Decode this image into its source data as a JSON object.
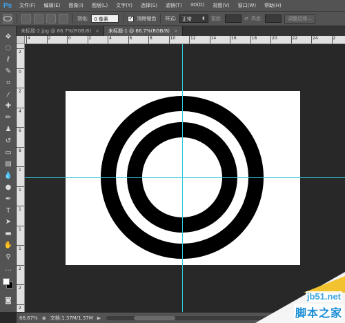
{
  "app": {
    "logo": "Ps"
  },
  "menu": [
    "文件(F)",
    "编辑(E)",
    "图像(I)",
    "图层(L)",
    "文字(Y)",
    "选择(S)",
    "滤镜(T)",
    "3D(D)",
    "视图(V)",
    "窗口(W)",
    "帮助(H)"
  ],
  "options": {
    "feather_label": "羽化:",
    "feather_value": "0 像素",
    "antialias_label": "消除锯齿",
    "antialias_checked": true,
    "style_label": "样式:",
    "style_value": "正常",
    "width_label": "宽度:",
    "height_label": "高度:",
    "refine_edge_label": "调整边缘..."
  },
  "tabs": [
    {
      "label": "未标题-2.jpg @ 66.7%(RGB/8)",
      "close": "×",
      "active": false
    },
    {
      "label": "未标题-1 @ 66.7%(RGB/8)",
      "close": "×",
      "active": true
    }
  ],
  "ruler_top": [
    "4",
    "2",
    "0",
    "2",
    "4",
    "6",
    "8",
    "10",
    "12",
    "14",
    "16",
    "18",
    "20",
    "22",
    "24",
    "2"
  ],
  "ruler_left": [
    "2",
    "0",
    "2",
    "4",
    "6",
    "8",
    "1",
    "1",
    "1",
    "1",
    "1",
    "2",
    "2",
    "2"
  ],
  "tools": [
    {
      "name": "move-tool",
      "glyph": "✥"
    },
    {
      "name": "marquee-tool",
      "glyph": "◌"
    },
    {
      "name": "lasso-tool",
      "glyph": "ℓ"
    },
    {
      "name": "quick-select-tool",
      "glyph": "✎"
    },
    {
      "name": "crop-tool",
      "glyph": "⌗"
    },
    {
      "name": "eyedropper-tool",
      "glyph": "⁄"
    },
    {
      "name": "healing-tool",
      "glyph": "✚"
    },
    {
      "name": "brush-tool",
      "glyph": "✏"
    },
    {
      "name": "stamp-tool",
      "glyph": "♟"
    },
    {
      "name": "history-brush-tool",
      "glyph": "↺"
    },
    {
      "name": "eraser-tool",
      "glyph": "▭"
    },
    {
      "name": "gradient-tool",
      "glyph": "▤"
    },
    {
      "name": "blur-tool",
      "glyph": "💧"
    },
    {
      "name": "dodge-tool",
      "glyph": "●"
    },
    {
      "name": "pen-tool",
      "glyph": "✒"
    },
    {
      "name": "type-tool",
      "glyph": "T"
    },
    {
      "name": "path-select-tool",
      "glyph": "➤"
    },
    {
      "name": "shape-tool",
      "glyph": "▬"
    },
    {
      "name": "hand-tool",
      "glyph": "✋"
    },
    {
      "name": "zoom-tool",
      "glyph": "⚲"
    },
    {
      "name": "extra-tool",
      "glyph": "…"
    }
  ],
  "status": {
    "zoom": "66.67%",
    "doc_info": "文档:1.37M/1.37M",
    "arrow": "▶"
  },
  "watermark": {
    "site": "jb51.net",
    "name": "脚本之家"
  }
}
